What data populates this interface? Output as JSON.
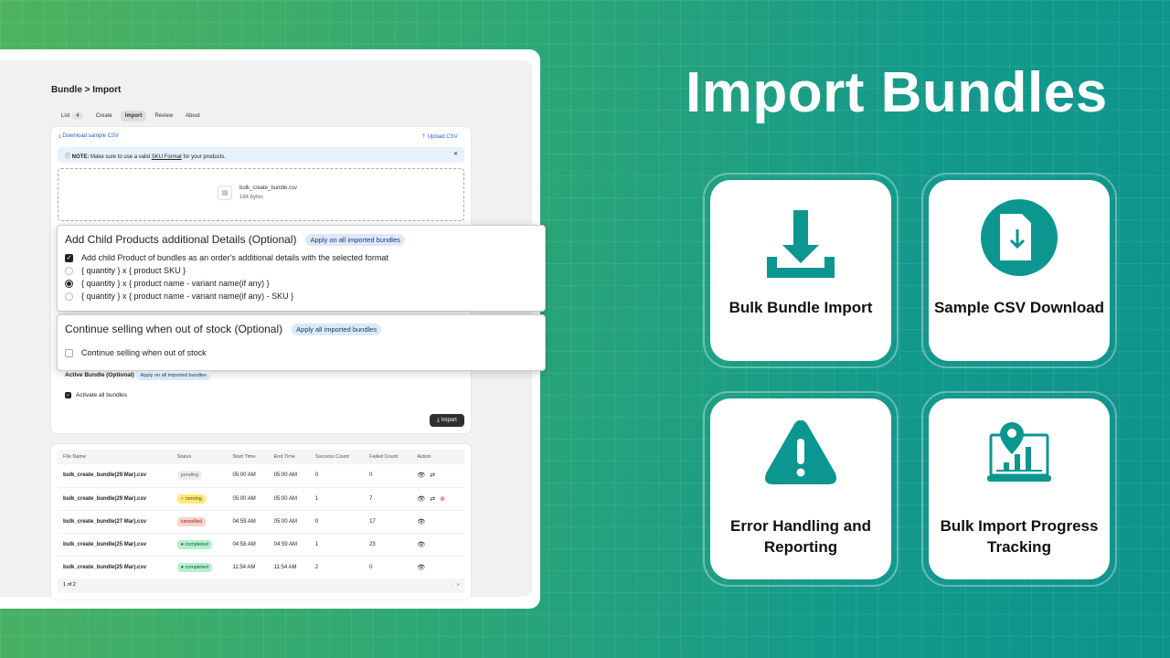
{
  "app": {
    "breadcrumb": "Bundle > Import",
    "tabs": [
      {
        "label": "List",
        "count": "4"
      },
      {
        "label": "Create"
      },
      {
        "label": "Import",
        "active": true
      },
      {
        "label": "Review"
      },
      {
        "label": "About"
      }
    ],
    "download_link": "Download sample CSV",
    "upload_link": "Upload CSV",
    "note": {
      "prefix": "NOTE:",
      "text1": " Make sure to use a valid ",
      "link": "SKU Format",
      "text2": " for your products."
    },
    "file": {
      "name": "bulk_create_bundle.csv",
      "size": "184 bytes"
    },
    "child_details": {
      "title": "Add Child Products additional Details (Optional)",
      "badge": "Apply on all imported bundles",
      "checkbox": "Add child Product of bundles as an order's additional details with the selected format",
      "options": [
        "{ quantity } x { product SKU }",
        "{ quantity } x { product name - variant name(if any) }",
        "{ quantity } x { product name - variant name(if any) - SKU }"
      ],
      "selected": 1
    },
    "continue_selling": {
      "title": "Continue selling when out of stock (Optional)",
      "badge": "Apply all imported bundles",
      "checkbox": "Continue selling when out of stock",
      "checked": false
    },
    "active_bundle": {
      "title": "Active Bundle (Optional)",
      "badge": "Apply on all imported bundles",
      "checkbox": "Activate all bundles",
      "checked": true
    },
    "import_button": "Import",
    "table": {
      "headers": [
        "File Name",
        "Status",
        "Start Time",
        "End Time",
        "Success Count",
        "Failed Count",
        "Action"
      ],
      "rows": [
        {
          "file": "bulk_create_bundle(29 Mar).csv",
          "status": "pending",
          "start": "05:00 AM",
          "end": "05:00 AM",
          "success": "0",
          "failed": "0",
          "actions": [
            "view",
            "retry"
          ]
        },
        {
          "file": "bulk_create_bundle(29 Mar).csv",
          "status": "running",
          "start": "05:00 AM",
          "end": "05:00 AM",
          "success": "1",
          "failed": "7",
          "actions": [
            "view",
            "retry",
            "cancel"
          ]
        },
        {
          "file": "bulk_create_bundle(27 Mar).csv",
          "status": "cancelled",
          "start": "04:59 AM",
          "end": "05:00 AM",
          "success": "0",
          "failed": "17",
          "actions": [
            "view"
          ]
        },
        {
          "file": "bulk_create_bundle(25 Mar).csv",
          "status": "completed",
          "start": "04:58 AM",
          "end": "04:59 AM",
          "success": "1",
          "failed": "23",
          "actions": [
            "view"
          ]
        },
        {
          "file": "bulk_create_bundle(25 Mar).csv",
          "status": "completed",
          "start": "11:54 AM",
          "end": "11:54 AM",
          "success": "2",
          "failed": "0",
          "actions": [
            "view"
          ]
        }
      ]
    },
    "pager": "1 of 2"
  },
  "hero": {
    "title": "Import Bundles",
    "features": [
      {
        "label": "Bulk Bundle Import",
        "icon": "download-tray-icon"
      },
      {
        "label": "Sample CSV Download",
        "icon": "file-download-icon"
      },
      {
        "label": "Error Handling and Reporting",
        "icon": "warning-icon"
      },
      {
        "label": "Bulk Import Progress Tracking",
        "icon": "laptop-chart-location-icon"
      }
    ]
  },
  "colors": {
    "accent": "#0b9690",
    "bg_start": "#4fb35f",
    "bg_end": "#0e928b"
  }
}
